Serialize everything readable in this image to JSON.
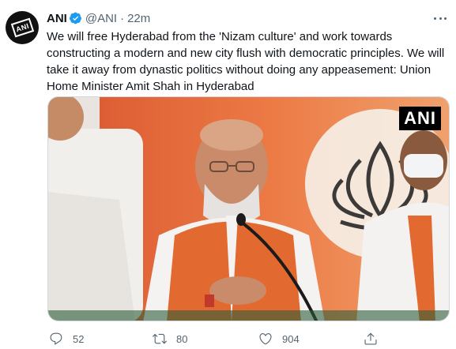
{
  "account": {
    "name": "ANI",
    "handle": "@ANI",
    "separator": "·",
    "time": "22m",
    "avatar_text": "ANI"
  },
  "tweet": {
    "text": "We will free Hyderabad from the 'Nizam culture' and work towards constructing a modern and new city flush with democratic principles. We will take it away from dynastic politics without doing any appeasement: Union Home Minister Amit Shah in Hyderabad"
  },
  "media": {
    "watermark": "ANI",
    "icon": "news-photo"
  },
  "actions": {
    "reply_count": "52",
    "retweet_count": "80",
    "like_count": "904"
  },
  "colors": {
    "text": "#0f1419",
    "muted": "#536471",
    "verified": "#1d9bf0",
    "backdrop_orange": "#e8683a",
    "vest_orange": "#e2692f"
  }
}
